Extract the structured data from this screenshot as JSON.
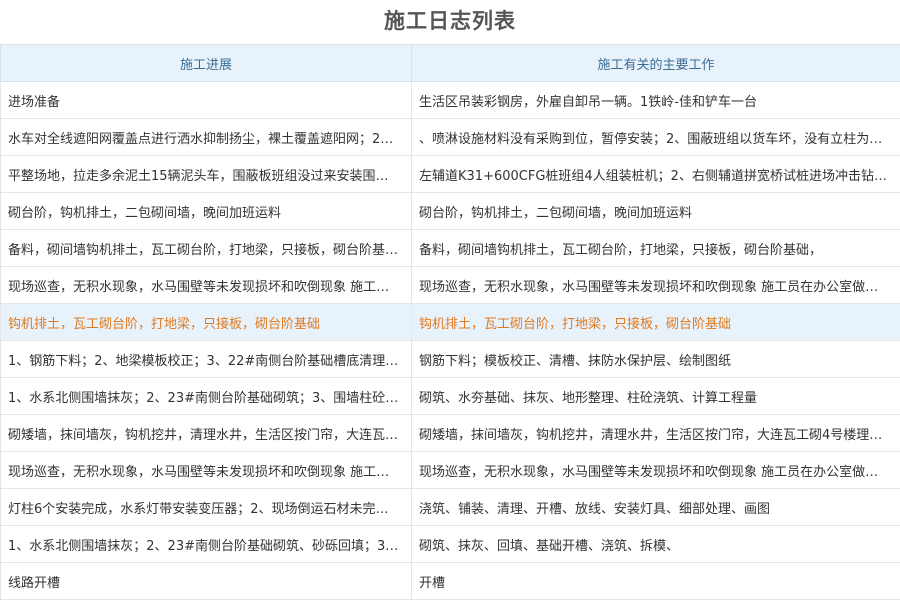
{
  "page": {
    "title": "施工日志列表"
  },
  "table": {
    "headers": [
      "施工进展",
      "施工有关的主要工作"
    ],
    "highlighted_row": 6,
    "rows": [
      [
        "进场准备",
        "生活区吊装彩钢房，外雇自卸吊一辆。1铁岭-佳和铲车一台"
      ],
      [
        "水车对全线遮阳网覆盖点进行洒水抑制扬尘，裸土覆盖遮阳网；2…",
        "、喷淋设施材料没有采购到位，暂停安装；2、围蔽班组以货车坏，没有立柱为理…"
      ],
      [
        "平整场地，拉走多余泥土15辆泥头车，围蔽板班组没过来安装围蔽…",
        "左辅道K31+600CFG桩班组4人组装桩机；2、右侧辅道拼宽桥试桩进场冲击钻一…"
      ],
      [
        "砌台阶，钩机排土，二包砌间墙，晚间加班运料",
        "砌台阶，钩机排土，二包砌间墙，晚间加班运料"
      ],
      [
        "备料，砌间墙钩机排土，瓦工砌台阶，打地梁，只接板，砌台阶基…",
        "备料，砌间墙钩机排土，瓦工砌台阶，打地梁，只接板，砌台阶基础，"
      ],
      [
        "现场巡查，无积水现象，水马围壁等未发现损坏和吹倒现象 施工…",
        "现场巡查，无积水现象，水马围壁等未发现损坏和吹倒现象 施工员在办公室做内…"
      ],
      [
        "钩机排土，瓦工砌台阶，打地梁，只接板，砌台阶基础",
        "钩机排土，瓦工砌台阶，打地梁，只接板，砌台阶基础"
      ],
      [
        "1、钢筋下料；2、地梁模板校正；3、22#南侧台阶基础槽底清理…",
        "钢筋下料；模板校正、清槽、抹防水保护层、绘制图纸"
      ],
      [
        "1、水系北侧围墙抹灰；2、23#南侧台阶基础砌筑；3、围墙柱砼…",
        "砌筑、水夯基础、抹灰、地形整理、柱砼浇筑、计算工程量"
      ],
      [
        "砌矮墙，抹间墙灰，钩机挖井，清理水井，生活区按门帘，大连瓦…",
        "砌矮墙，抹间墙灰，钩机挖井，清理水井，生活区按门帘，大连瓦工砌4号楼理石板"
      ],
      [
        "现场巡查，无积水现象，水马围壁等未发现损坏和吹倒现象 施工…",
        "现场巡查，无积水现象，水马围壁等未发现损坏和吹倒现象 施工员在办公室做内…"
      ],
      [
        "灯柱6个安装完成，水系灯带安装变压器；2、现场倒运石材未完成…",
        "浇筑、铺装、清理、开槽、放线、安装灯具、细部处理、画图"
      ],
      [
        "1、水系北侧围墙抹灰；2、23#南侧台阶基础砌筑、砂砾回填；3…",
        "砌筑、抹灰、回填、基础开槽、浇筑、拆模、"
      ],
      [
        "线路开槽",
        "开槽"
      ]
    ]
  }
}
